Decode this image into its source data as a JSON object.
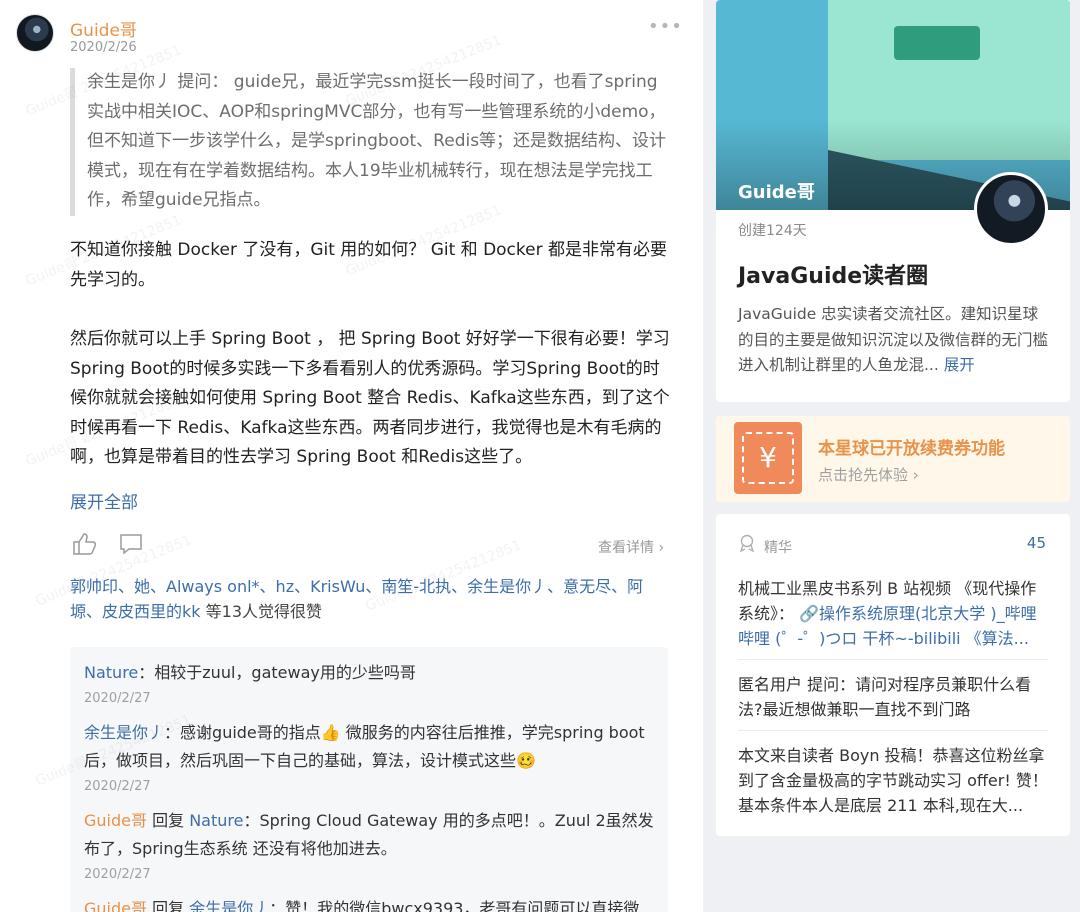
{
  "post": {
    "author": "Guide哥",
    "date": "2020/2/26",
    "more_icon": "more-dots-icon",
    "quote": "余生是你丿  提问： guide兄，最近学完ssm挺长一段时间了，也看了spring实战中相关IOC、AOP和springMVC部分，也有写一些管理系统的小demo，但不知道下一步该学什么，是学springboot、Redis等；还是数据结构、设计模式，现在有在学着数据结构。本人19毕业机械转行，现在想法是学完找工作，希望guide兄指点。",
    "para1": "不知道你接触 Docker 了没有，Git 用的如何？  Git 和 Docker 都是非常有必要先学习的。",
    "para2": "然后你就可以上手 Spring Boot ， 把 Spring Boot 好好学一下很有必要！学习 Spring Boot的时候多实践一下多看看别人的优秀源码。学习Spring Boot的时候你就就会接触如何使用 Spring Boot 整合 Redis、Kafka这些东西，到了这个时候再看一下 Redis、Kafka这些东西。两者同步进行，我觉得也是木有毛病的啊，也算是带着目的性去学习 Spring Boot 和Redis这些了。",
    "expand_all": "展开全部",
    "view_detail": "查看详情 ›",
    "likers_names": "郭帅印、她、Always onl*、hz、KrisWu、南笙-北执、余生是你丿、意无尽、阿塬、皮皮西里的kk",
    "likers_suffix": " 等13人觉得很赞",
    "watermark": "Guide哥 224254212851"
  },
  "comments": [
    {
      "name": "Nature",
      "sep": "：",
      "text": "相较于zuul，gateway用的少些吗哥",
      "date": "2020/2/27",
      "orange": false
    },
    {
      "name": "余生是你丿",
      "sep": "：",
      "text": "感谢guide哥的指点👍        微服务的内容往后推推，学完spring boot后，做项目，然后巩固一下自己的基础，算法，设计模式这些🥴",
      "date": "2020/2/27",
      "orange": false
    },
    {
      "name": "Guide哥",
      "sep": " 回复 ",
      "reply_to": "Nature",
      "text": "：Spring Cloud Gateway 用的多点吧！。Zuul 2虽然发布了，Spring生态系统 还没有将他加进去。",
      "date": "2020/2/27",
      "orange": true
    },
    {
      "name": "Guide哥",
      "sep": " 回复 ",
      "reply_to": "余生是你丿",
      "text": "：赞！我的微信bwcx9393，老哥有问题可以直接微",
      "date": "",
      "orange": true
    }
  ],
  "circle": {
    "banner_name": "Guide哥",
    "created": "创建124天",
    "title": "JavaGuide读者圈",
    "desc": "JavaGuide 忠实读者交流社区。建知识星球的目的主要是做知识沉淀以及微信群的无门槛进入机制让群里的人鱼龙混... ",
    "expand": "展开"
  },
  "coupon": {
    "symbol": "¥",
    "title": "本星球已开放续费券功能",
    "sub": "点击抢先体验 ›"
  },
  "featured": {
    "label": "精华",
    "count": "45",
    "items": [
      {
        "pre": "机械工业黑皮书系列 B 站视频 《现代操作系统》： ",
        "link": "🔗操作系统原理(北京大学 )_哔哩哔哩 (゜-゜)つロ 干杯~-bilibili 《算法...",
        "post": ""
      },
      {
        "pre": "匿名用户  提问：请问对程序员兼职什么看法?最近想做兼职一直找不到门路",
        "link": "",
        "post": ""
      },
      {
        "pre": "本文来自读者 Boyn 投稿！恭喜这位粉丝拿到了含金量极高的字节跳动实习 offer! 赞！基本条件本人是底层 211 本科,现在大...",
        "link": "",
        "post": ""
      }
    ]
  }
}
